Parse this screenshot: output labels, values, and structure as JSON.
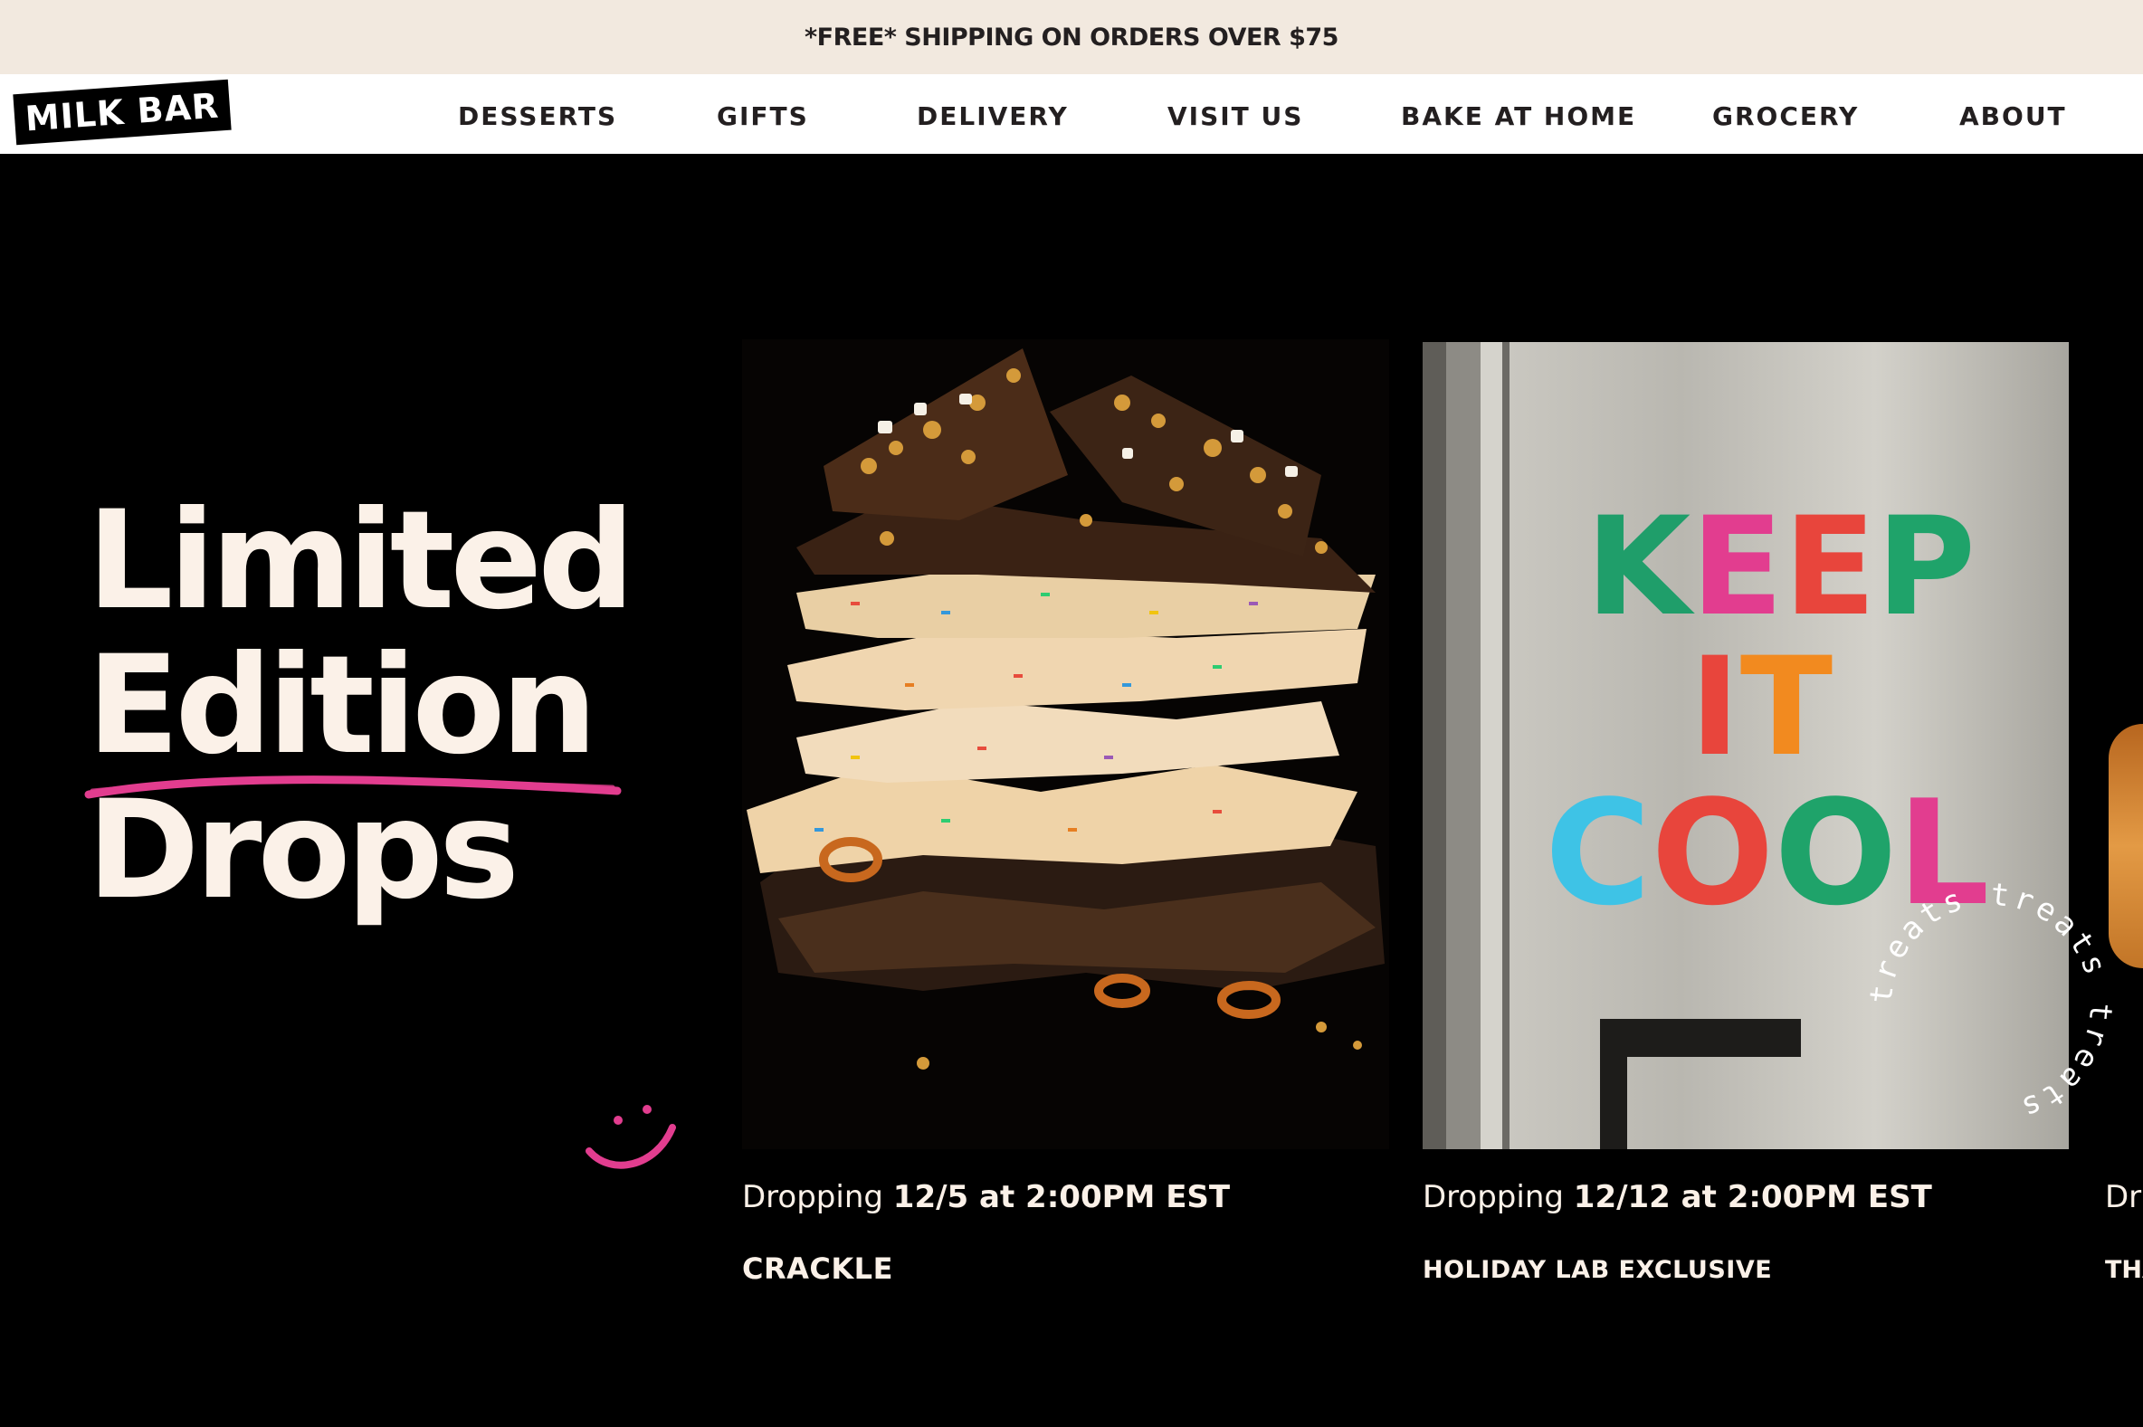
{
  "announcement": {
    "text": "*FREE* SHIPPING ON ORDERS OVER $75"
  },
  "logo": {
    "text": "MILK BAR"
  },
  "nav": {
    "items": [
      {
        "label": "DESSERTS"
      },
      {
        "label": "GIFTS"
      },
      {
        "label": "DELIVERY"
      },
      {
        "label": "VISIT US"
      },
      {
        "label": "BAKE AT HOME"
      },
      {
        "label": "GROCERY"
      },
      {
        "label": "ABOUT"
      }
    ]
  },
  "hero": {
    "headline": [
      "Limited",
      "Edition",
      "Drops"
    ],
    "accent_color": "#e23d8f",
    "text_color": "#fbf1e8",
    "background": "#000000"
  },
  "drops": [
    {
      "prefix": "Dropping",
      "when": "12/5 at 2:00PM EST",
      "name": "CRACKLE",
      "image": "crackle-stack-photo"
    },
    {
      "prefix": "Dropping",
      "when": "12/12 at 2:00PM EST",
      "name": "HOLIDAY LAB EXCLUSIVE",
      "image": "keep-it-cool-fridge-photo",
      "magnets": {
        "line1": "KEEP",
        "line2": "IT",
        "line3": "COOL"
      },
      "badge_text": "treats treats treats"
    },
    {
      "prefix": "Dr",
      "name": "THA"
    }
  ]
}
